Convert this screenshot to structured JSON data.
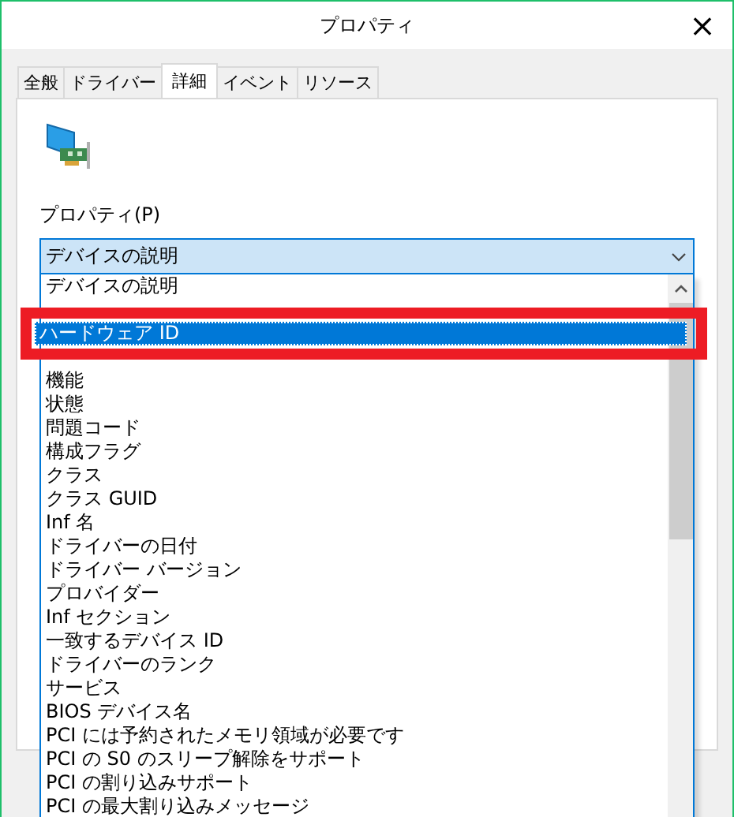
{
  "window": {
    "title": "プロパティ",
    "close": "×"
  },
  "tabs": [
    {
      "label": "全般",
      "selected": false
    },
    {
      "label": "ドライバー",
      "selected": false
    },
    {
      "label": "詳細",
      "selected": true
    },
    {
      "label": "イベント",
      "selected": false
    },
    {
      "label": "リソース",
      "selected": false
    }
  ],
  "property": {
    "label": "プロパティ(P)",
    "value": "デバイスの説明",
    "expanded": true
  },
  "dropdown_items": [
    {
      "label": "デバイスの説明",
      "selected": false
    },
    {
      "label": "ハードウェア ID",
      "selected": true
    },
    {
      "label": "機能",
      "selected": false
    },
    {
      "label": "状態",
      "selected": false
    },
    {
      "label": "問題コード",
      "selected": false
    },
    {
      "label": "構成フラグ",
      "selected": false
    },
    {
      "label": "クラス",
      "selected": false
    },
    {
      "label": "クラス GUID",
      "selected": false
    },
    {
      "label": "Inf 名",
      "selected": false
    },
    {
      "label": "ドライバーの日付",
      "selected": false
    },
    {
      "label": "ドライバー バージョン",
      "selected": false
    },
    {
      "label": "プロバイダー",
      "selected": false
    },
    {
      "label": "Inf セクション",
      "selected": false
    },
    {
      "label": "一致するデバイス ID",
      "selected": false
    },
    {
      "label": "ドライバーのランク",
      "selected": false
    },
    {
      "label": "サービス",
      "selected": false
    },
    {
      "label": "BIOS デバイス名",
      "selected": false
    },
    {
      "label": "PCI には予約されたメモリ領域が必要です",
      "selected": false
    },
    {
      "label": "PCI の S0 のスリープ解除をサポート",
      "selected": false
    },
    {
      "label": "PCI の割り込みサポート",
      "selected": false
    },
    {
      "label": "PCI の最大割り込みメッセージ",
      "selected": false
    }
  ]
}
